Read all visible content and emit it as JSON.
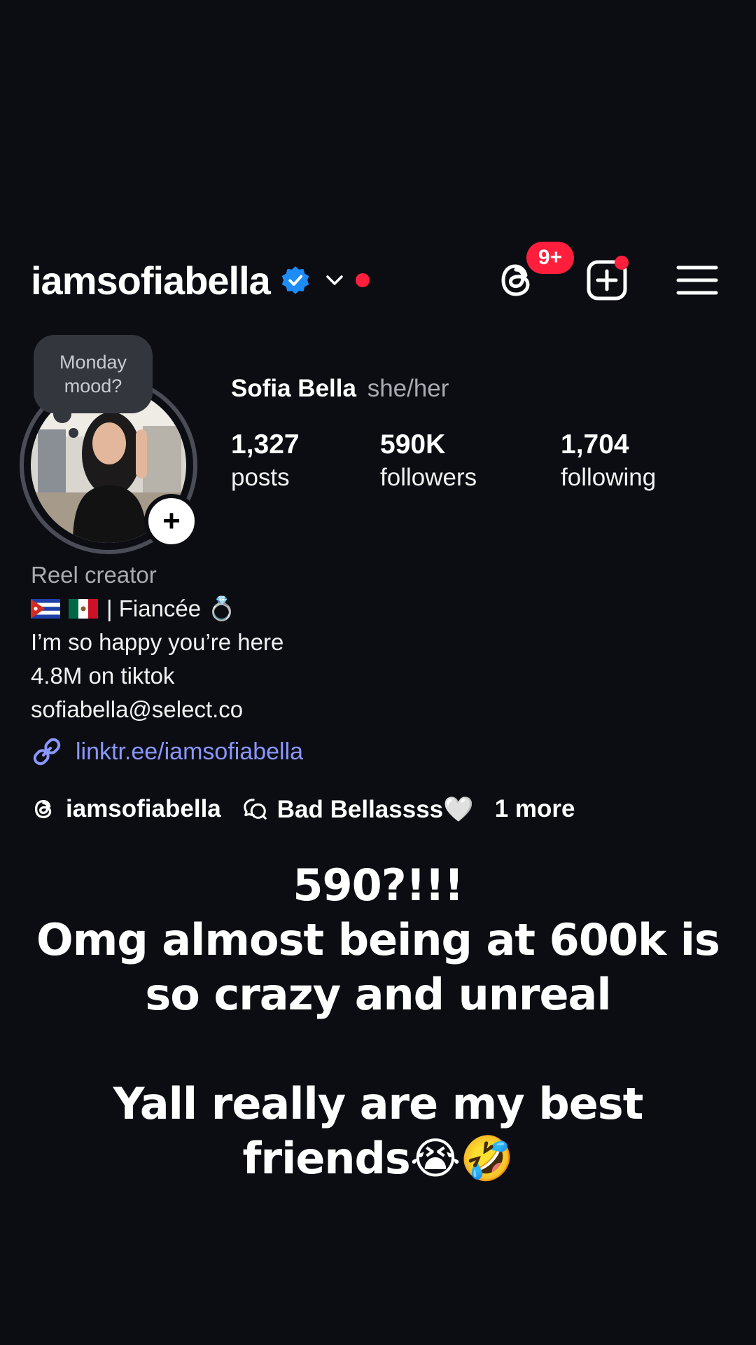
{
  "header": {
    "username": "iamsofiabella",
    "threads_badge": "9+",
    "icons": {
      "verified": "verified-badge-icon",
      "chevron": "chevron-down-icon",
      "threads": "threads-icon",
      "create": "create-plus-icon",
      "menu": "hamburger-menu-icon"
    }
  },
  "note": {
    "text_line1": "Monday",
    "text_line2": "mood?"
  },
  "profile": {
    "name": "Sofia Bella",
    "pronouns": "she/her",
    "stats": {
      "posts_value": "1,327",
      "posts_label": "posts",
      "followers_value": "590K",
      "followers_label": "followers",
      "following_value": "1,704",
      "following_label": "following"
    }
  },
  "bio": {
    "category": "Reel creator",
    "line1_text": "| Fiancée 💍",
    "line2": "I’m so happy you’re here",
    "line3": "4.8M on tiktok",
    "line4": "sofiabella@select.co",
    "link": "linktr.ee/iamsofiabella",
    "flags": [
      "cuba-flag-icon",
      "mexico-flag-icon"
    ]
  },
  "chips": {
    "threads_handle": "iamsofiabella",
    "channel": "Bad Bellassss🤍",
    "more": "1 more"
  },
  "caption": {
    "line1": "590?!!!",
    "line2": "Omg almost being at 600k is",
    "line3": "so crazy and unreal",
    "line4": "Yall really are my best",
    "line5": "friends😭🤣"
  },
  "colors": {
    "background": "#0b0d12",
    "badge_red": "#ff1f3d",
    "verified_blue": "#1d8cf8",
    "link_blue": "#8b96ff"
  }
}
